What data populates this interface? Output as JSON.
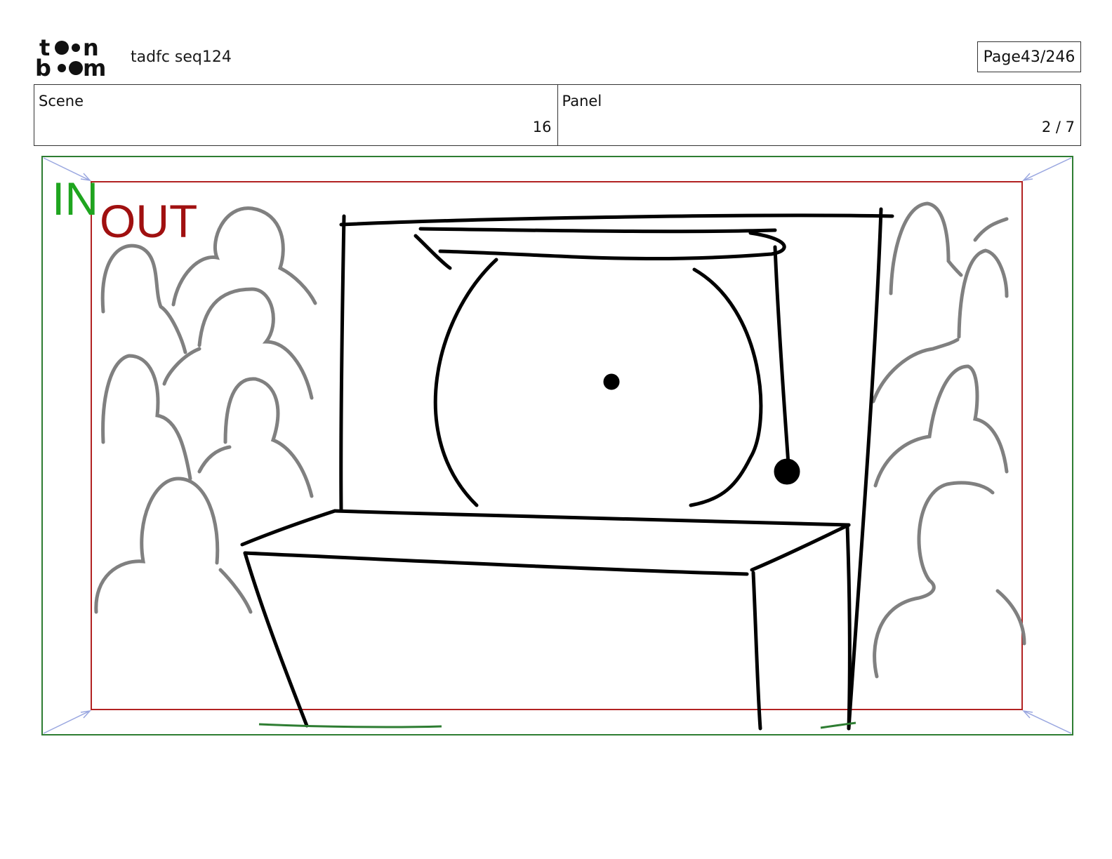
{
  "header": {
    "logo_text": "toon boom",
    "project": "tadfc seq124",
    "page_label": "Page",
    "page_value": "43/246"
  },
  "info": {
    "scene_label": "Scene",
    "scene_value": "16",
    "panel_label": "Panel",
    "panel_value": "2 / 7"
  },
  "frame": {
    "in_label": "IN",
    "out_label": "OUT",
    "in_color": "#1fa51f",
    "out_color": "#a01010",
    "safe_frame_color": "#2e7d32",
    "title_frame_color": "#b22222",
    "sketch_color": "#000000",
    "background_figures_color": "#808080"
  }
}
